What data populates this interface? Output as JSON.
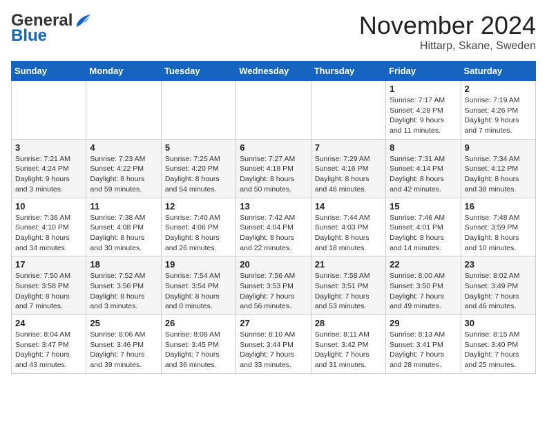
{
  "logo": {
    "line1": "General",
    "line2": "Blue"
  },
  "title": "November 2024",
  "location": "Hittarp, Skane, Sweden",
  "days_of_week": [
    "Sunday",
    "Monday",
    "Tuesday",
    "Wednesday",
    "Thursday",
    "Friday",
    "Saturday"
  ],
  "weeks": [
    [
      {
        "day": "",
        "detail": ""
      },
      {
        "day": "",
        "detail": ""
      },
      {
        "day": "",
        "detail": ""
      },
      {
        "day": "",
        "detail": ""
      },
      {
        "day": "",
        "detail": ""
      },
      {
        "day": "1",
        "detail": "Sunrise: 7:17 AM\nSunset: 4:28 PM\nDaylight: 9 hours and 11 minutes."
      },
      {
        "day": "2",
        "detail": "Sunrise: 7:19 AM\nSunset: 4:26 PM\nDaylight: 9 hours and 7 minutes."
      }
    ],
    [
      {
        "day": "3",
        "detail": "Sunrise: 7:21 AM\nSunset: 4:24 PM\nDaylight: 9 hours and 3 minutes."
      },
      {
        "day": "4",
        "detail": "Sunrise: 7:23 AM\nSunset: 4:22 PM\nDaylight: 8 hours and 59 minutes."
      },
      {
        "day": "5",
        "detail": "Sunrise: 7:25 AM\nSunset: 4:20 PM\nDaylight: 8 hours and 54 minutes."
      },
      {
        "day": "6",
        "detail": "Sunrise: 7:27 AM\nSunset: 4:18 PM\nDaylight: 8 hours and 50 minutes."
      },
      {
        "day": "7",
        "detail": "Sunrise: 7:29 AM\nSunset: 4:16 PM\nDaylight: 8 hours and 46 minutes."
      },
      {
        "day": "8",
        "detail": "Sunrise: 7:31 AM\nSunset: 4:14 PM\nDaylight: 8 hours and 42 minutes."
      },
      {
        "day": "9",
        "detail": "Sunrise: 7:34 AM\nSunset: 4:12 PM\nDaylight: 8 hours and 38 minutes."
      }
    ],
    [
      {
        "day": "10",
        "detail": "Sunrise: 7:36 AM\nSunset: 4:10 PM\nDaylight: 8 hours and 34 minutes."
      },
      {
        "day": "11",
        "detail": "Sunrise: 7:38 AM\nSunset: 4:08 PM\nDaylight: 8 hours and 30 minutes."
      },
      {
        "day": "12",
        "detail": "Sunrise: 7:40 AM\nSunset: 4:06 PM\nDaylight: 8 hours and 26 minutes."
      },
      {
        "day": "13",
        "detail": "Sunrise: 7:42 AM\nSunset: 4:04 PM\nDaylight: 8 hours and 22 minutes."
      },
      {
        "day": "14",
        "detail": "Sunrise: 7:44 AM\nSunset: 4:03 PM\nDaylight: 8 hours and 18 minutes."
      },
      {
        "day": "15",
        "detail": "Sunrise: 7:46 AM\nSunset: 4:01 PM\nDaylight: 8 hours and 14 minutes."
      },
      {
        "day": "16",
        "detail": "Sunrise: 7:48 AM\nSunset: 3:59 PM\nDaylight: 8 hours and 10 minutes."
      }
    ],
    [
      {
        "day": "17",
        "detail": "Sunrise: 7:50 AM\nSunset: 3:58 PM\nDaylight: 8 hours and 7 minutes."
      },
      {
        "day": "18",
        "detail": "Sunrise: 7:52 AM\nSunset: 3:56 PM\nDaylight: 8 hours and 3 minutes."
      },
      {
        "day": "19",
        "detail": "Sunrise: 7:54 AM\nSunset: 3:54 PM\nDaylight: 8 hours and 0 minutes."
      },
      {
        "day": "20",
        "detail": "Sunrise: 7:56 AM\nSunset: 3:53 PM\nDaylight: 7 hours and 56 minutes."
      },
      {
        "day": "21",
        "detail": "Sunrise: 7:58 AM\nSunset: 3:51 PM\nDaylight: 7 hours and 53 minutes."
      },
      {
        "day": "22",
        "detail": "Sunrise: 8:00 AM\nSunset: 3:50 PM\nDaylight: 7 hours and 49 minutes."
      },
      {
        "day": "23",
        "detail": "Sunrise: 8:02 AM\nSunset: 3:49 PM\nDaylight: 7 hours and 46 minutes."
      }
    ],
    [
      {
        "day": "24",
        "detail": "Sunrise: 8:04 AM\nSunset: 3:47 PM\nDaylight: 7 hours and 43 minutes."
      },
      {
        "day": "25",
        "detail": "Sunrise: 8:06 AM\nSunset: 3:46 PM\nDaylight: 7 hours and 39 minutes."
      },
      {
        "day": "26",
        "detail": "Sunrise: 8:08 AM\nSunset: 3:45 PM\nDaylight: 7 hours and 36 minutes."
      },
      {
        "day": "27",
        "detail": "Sunrise: 8:10 AM\nSunset: 3:44 PM\nDaylight: 7 hours and 33 minutes."
      },
      {
        "day": "28",
        "detail": "Sunrise: 8:11 AM\nSunset: 3:42 PM\nDaylight: 7 hours and 31 minutes."
      },
      {
        "day": "29",
        "detail": "Sunrise: 8:13 AM\nSunset: 3:41 PM\nDaylight: 7 hours and 28 minutes."
      },
      {
        "day": "30",
        "detail": "Sunrise: 8:15 AM\nSunset: 3:40 PM\nDaylight: 7 hours and 25 minutes."
      }
    ]
  ]
}
